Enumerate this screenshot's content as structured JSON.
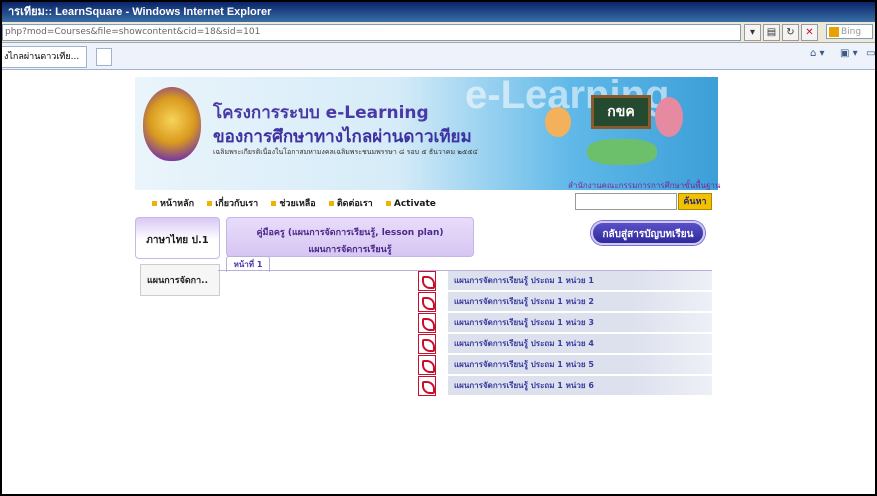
{
  "window": {
    "title": "ารเทียม:: LearnSquare - Windows Internet Explorer"
  },
  "address_bar": {
    "url": "php?mod=Courses&file=showcontent&cid=18&sid=101",
    "search_placeholder": "Bing"
  },
  "browser_tab": {
    "label": "งไกลผ่านดาวเทีย..."
  },
  "banner": {
    "title": "โครงการระบบ e-Learning",
    "subtitle": "ของการศึกษาทางไกลผ่านดาวเทียม",
    "note": "เฉลิมพระเกียรติเนื่องในโอกาสมหามงคลเฉลิมพระชนมพรรษา ๘ รอบ ๕ ธันวาคม ๒๕๕๔",
    "watermark": "e-Learning",
    "board_text": "กขค",
    "agency": "สำนักงานคณะกรรมการการศึกษาขั้นพื้นฐาน"
  },
  "nav": {
    "items": [
      "หน้าหลัก",
      "เกี่ยวกับเรา",
      "ช่วยเหลือ",
      "ติดต่อเรา",
      "Activate"
    ]
  },
  "search": {
    "button": "ค้นหา"
  },
  "sidebar": {
    "course": "ภาษาไทย ป.1",
    "menu_item": "แผนการจัดกา.."
  },
  "info": {
    "line1": "คู่มือครู (แผนการจัดการเรียนรู้, lesson plan)",
    "line2": "แผนการจัดการเรียนรู้"
  },
  "back_button": "กลับสู่สารบัญบทเรียน",
  "page_tab": "หน้าที่ 1",
  "lessons": [
    "แผนการจัดการเรียนรู้ ประถม 1 หน่วย 1",
    "แผนการจัดการเรียนรู้ ประถม 1 หน่วย 2",
    "แผนการจัดการเรียนรู้ ประถม 1 หน่วย 3",
    "แผนการจัดการเรียนรู้ ประถม 1 หน่วย 4",
    "แผนการจัดการเรียนรู้ ประถม 1 หน่วย 5",
    "แผนการจัดการเรียนรู้ ประถม 1 หน่วย 6"
  ],
  "colors": {
    "accent": "#4a3aa5",
    "lesson_text": "#3b3c9e",
    "pdf_icon": "#c8102e"
  }
}
